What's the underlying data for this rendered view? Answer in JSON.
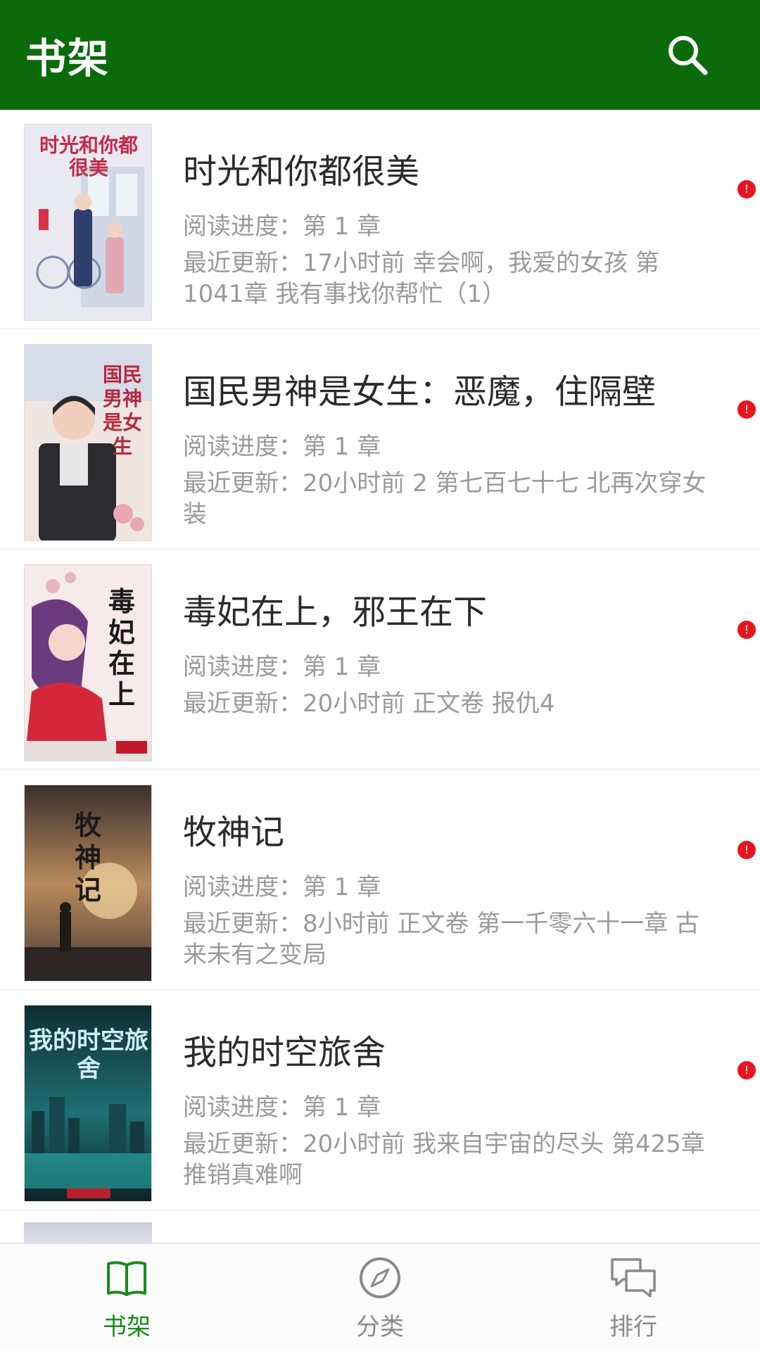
{
  "app_bar": {
    "title": "书架",
    "search_icon": "search-icon",
    "color": "#0b6b0b"
  },
  "books": [
    {
      "title": "时光和你都很美",
      "progress": "阅读进度：第 1 章",
      "update": "最近更新：17小时前  幸会啊，我爱的女孩 第1041章 我有事找你帮忙（1）",
      "cover_text": "时光和你都很美"
    },
    {
      "title": "国民男神是女生：恶魔，住隔壁",
      "progress": "阅读进度：第 1 章",
      "update": "最近更新：20小时前  2 第七百七十七 北再次穿女装",
      "cover_text": "国民男神是女生"
    },
    {
      "title": "毒妃在上，邪王在下",
      "progress": "阅读进度：第 1 章",
      "update": "最近更新：20小时前  正文卷 报仇4",
      "cover_text": "毒妃在上"
    },
    {
      "title": "牧神记",
      "progress": "阅读进度：第 1 章",
      "update": "最近更新：8小时前  正文卷 第一千零六十一章 古来未有之变局",
      "cover_text": "牧神记"
    },
    {
      "title": "我的时空旅舍",
      "progress": "阅读进度：第 1 章",
      "update": "最近更新：20小时前  我来自宇宙的尽头 第425章 推销真难啊",
      "cover_text": "我的时空旅舍"
    }
  ],
  "bottom_nav": [
    {
      "label": "书架",
      "icon": "book-icon",
      "active": true
    },
    {
      "label": "分类",
      "icon": "compass-icon",
      "active": false
    },
    {
      "label": "排行",
      "icon": "chat-bubbles-icon",
      "active": false
    }
  ],
  "colors": {
    "accent": "#1a8a1a",
    "badge": "#e8141d"
  }
}
